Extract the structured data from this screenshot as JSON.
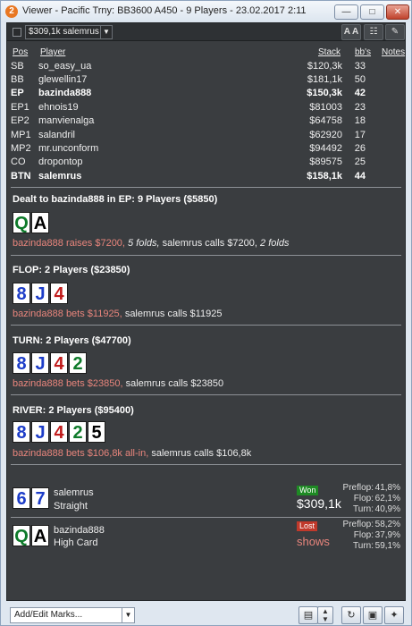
{
  "window": {
    "title": "Viewer - Pacific Trny: BB3600 A450 - 9 Players - 23.02.2017 2:11",
    "app_icon_glyph": "2",
    "minimize_glyph": "—",
    "maximize_glyph": "□",
    "close_glyph": "✕"
  },
  "toolbar": {
    "player_select": "$309,1k salemrus",
    "font_button": "A A",
    "grid_button": "☷",
    "edit_button": "✎"
  },
  "table_headers": {
    "pos": "Pos",
    "player": "Player",
    "stack": "Stack",
    "bbs": "bb's",
    "notes": "Notes"
  },
  "players": [
    {
      "pos": "SB",
      "name": "so_easy_ua",
      "stack": "$120,3k",
      "bbs": "33",
      "bold": false
    },
    {
      "pos": "BB",
      "name": "glewellin17",
      "stack": "$181,1k",
      "bbs": "50",
      "bold": false
    },
    {
      "pos": "EP",
      "name": "bazinda888",
      "stack": "$150,3k",
      "bbs": "42",
      "bold": true
    },
    {
      "pos": "EP1",
      "name": "ehnois19",
      "stack": "$81003",
      "bbs": "23",
      "bold": false
    },
    {
      "pos": "EP2",
      "name": "manvienalga",
      "stack": "$64758",
      "bbs": "18",
      "bold": false
    },
    {
      "pos": "MP1",
      "name": "salandril",
      "stack": "$62920",
      "bbs": "17",
      "bold": false
    },
    {
      "pos": "MP2",
      "name": "mr.unconform",
      "stack": "$94492",
      "bbs": "26",
      "bold": false
    },
    {
      "pos": "CO",
      "name": "dropontop",
      "stack": "$89575",
      "bbs": "25",
      "bold": false
    },
    {
      "pos": "BTN",
      "name": "salemrus",
      "stack": "$158,1k",
      "bbs": "44",
      "bold": true
    }
  ],
  "preflop": {
    "header": "Dealt to bazinda888 in EP: 9 Players ($5850)",
    "cards": [
      {
        "rank": "Q",
        "color": "green"
      },
      {
        "rank": "A",
        "color": "black"
      }
    ],
    "action_hero": "bazinda888 raises $7200,",
    "action_folds1": "5 folds,",
    "action_call": "salemrus calls $7200,",
    "action_folds2": "2 folds"
  },
  "flop": {
    "header": "FLOP: 2 Players ($23850)",
    "cards": [
      {
        "rank": "8",
        "color": "blue"
      },
      {
        "rank": "J",
        "color": "blue"
      },
      {
        "rank": "4",
        "color": "red"
      }
    ],
    "action_hero": "bazinda888 bets $11925,",
    "action_other": "salemrus calls $11925"
  },
  "turn": {
    "header": "TURN: 2 Players ($47700)",
    "cards": [
      {
        "rank": "8",
        "color": "blue"
      },
      {
        "rank": "J",
        "color": "blue"
      },
      {
        "rank": "4",
        "color": "red"
      },
      {
        "rank": "2",
        "color": "green"
      }
    ],
    "action_hero": "bazinda888 bets $23850,",
    "action_other": "salemrus calls $23850"
  },
  "river": {
    "header": "RIVER: 2 Players ($95400)",
    "cards": [
      {
        "rank": "8",
        "color": "blue"
      },
      {
        "rank": "J",
        "color": "blue"
      },
      {
        "rank": "4",
        "color": "red"
      },
      {
        "rank": "2",
        "color": "green"
      },
      {
        "rank": "5",
        "color": "black"
      }
    ],
    "action_hero": "bazinda888 bets $106,8k all-in,",
    "action_other": "salemrus calls $106,8k"
  },
  "showdown": [
    {
      "name": "salemrus",
      "hand": "Straight",
      "cards": [
        {
          "rank": "6",
          "color": "blue"
        },
        {
          "rank": "7",
          "color": "blue"
        }
      ],
      "result_badge": "Won",
      "result_text": "$309,1k",
      "stats": [
        {
          "label": "Preflop:",
          "value": "41,8%"
        },
        {
          "label": "Flop:",
          "value": "62,1%"
        },
        {
          "label": "Turn:",
          "value": "40,9%"
        }
      ]
    },
    {
      "name": "bazinda888",
      "hand": "High Card",
      "cards": [
        {
          "rank": "Q",
          "color": "green"
        },
        {
          "rank": "A",
          "color": "black"
        }
      ],
      "result_badge": "Lost",
      "result_text": "shows",
      "stats": [
        {
          "label": "Preflop:",
          "value": "58,2%"
        },
        {
          "label": "Flop:",
          "value": "37,9%"
        },
        {
          "label": "Turn:",
          "value": "59,1%"
        }
      ]
    }
  ],
  "bottom": {
    "marks_placeholder": "Add/Edit Marks...",
    "icons": [
      "clipboard-icon",
      "spin-icon",
      "refresh-icon",
      "save-icon",
      "twitter-icon"
    ]
  },
  "colors": {
    "hero": "#e8857c",
    "won": "#1e8a24",
    "lost": "#c0392b",
    "bg": "#3a3d40"
  }
}
